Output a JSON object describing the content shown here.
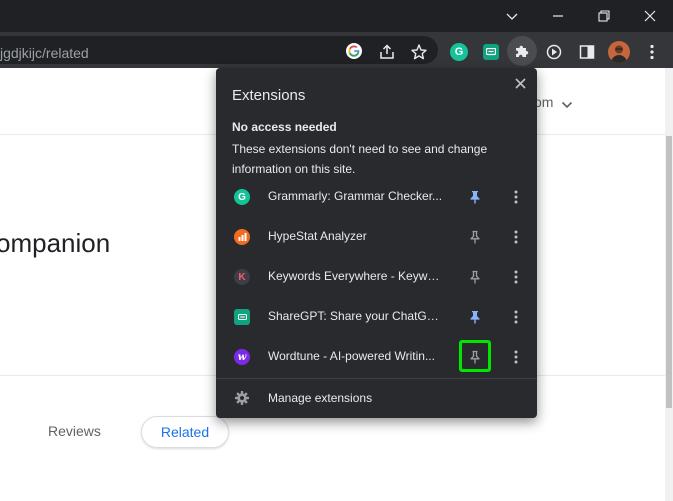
{
  "browser": {
    "url_text": "jgdjkijc/related",
    "window_controls": [
      "chevron-down-icon",
      "minimize-icon",
      "restore-icon",
      "close-icon"
    ],
    "toolbar_icons": [
      "google-lens-icon",
      "share-icon",
      "bookmark-star-icon",
      "grammarly-icon",
      "sharegpt-icon",
      "extensions-puzzle-icon",
      "media-icon",
      "side-panel-icon",
      "profile-avatar",
      "menu-kebab-icon"
    ]
  },
  "page": {
    "account_text": "om",
    "title_text": "ompanion",
    "tabs": {
      "reviews_label": "Reviews",
      "related_label": "Related"
    },
    "colors": {
      "link_blue": "#1a73e8"
    }
  },
  "extensions_popup": {
    "title": "Extensions",
    "section_heading": "No access needed",
    "section_description": "These extensions don't need to see and change information on this site.",
    "items": [
      {
        "name": "Grammarly: Grammar Checker...",
        "icon": "grammarly-icon",
        "icon_color": "#15c39a",
        "pinned": true
      },
      {
        "name": "HypeStat Analyzer",
        "icon": "hypestat-icon",
        "icon_color": "#f26b21",
        "pinned": false
      },
      {
        "name": "Keywords Everywhere - Keywor...",
        "icon": "keywords-everywhere-icon",
        "icon_color": "#3c3f47",
        "pinned": false
      },
      {
        "name": "ShareGPT: Share your ChatGPT...",
        "icon": "sharegpt-icon",
        "icon_color": "#10a37f",
        "pinned": true
      },
      {
        "name": "Wordtune - AI-powered Writin...",
        "icon": "wordtune-icon",
        "icon_color": "#7d2ae8",
        "pinned": false,
        "highlighted": true
      }
    ],
    "manage_label": "Manage extensions",
    "colors": {
      "pinned": "#8ab4f8",
      "unpinned": "#9aa0a6",
      "highlight": "#00e600"
    }
  }
}
